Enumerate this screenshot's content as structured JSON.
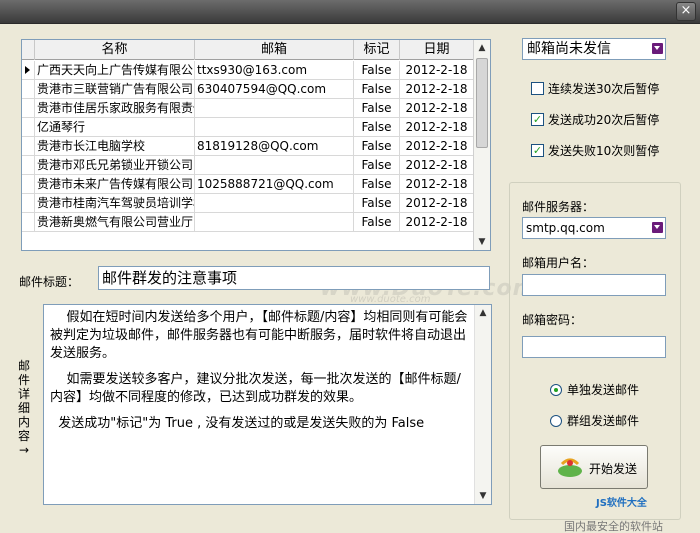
{
  "window": {
    "close_glyph": "×"
  },
  "grid": {
    "columns": [
      "名称",
      "邮箱",
      "标记",
      "日期"
    ],
    "rows": [
      {
        "name": "广西天天向上广告传媒有限公司",
        "email": "ttxs930@163.com",
        "flag": "False",
        "date": "2012-2-18",
        "current": true
      },
      {
        "name": "贵港市三联营销广告有限公司",
        "email": "630407594@QQ.com",
        "flag": "False",
        "date": "2012-2-18"
      },
      {
        "name": "贵港市佳居乐家政服务有限责任公司",
        "email": "",
        "flag": "False",
        "date": "2012-2-18"
      },
      {
        "name": "亿通琴行",
        "email": "",
        "flag": "False",
        "date": "2012-2-18"
      },
      {
        "name": "贵港市长江电脑学校",
        "email": "81819128@QQ.com",
        "flag": "False",
        "date": "2012-2-18"
      },
      {
        "name": "贵港市邓氏兄弟锁业开锁公司",
        "email": "",
        "flag": "False",
        "date": "2012-2-18"
      },
      {
        "name": "贵港市未来广告传媒有限公司",
        "email": "1025888721@QQ.com",
        "flag": "False",
        "date": "2012-2-18"
      },
      {
        "name": "贵港市桂南汽车驾驶员培训学校",
        "email": "",
        "flag": "False",
        "date": "2012-2-18"
      },
      {
        "name": "贵港新奥燃气有限公司营业厅",
        "email": "",
        "flag": "False",
        "date": "2012-2-18"
      }
    ]
  },
  "subject": {
    "label": "邮件标题：",
    "value": "邮件群发的注意事项"
  },
  "body": {
    "label_chars": [
      "邮",
      "件",
      "详",
      "细",
      "内",
      "容",
      "→"
    ],
    "paragraphs": [
      "    假如在短时间内发送给多个用户，【邮件标题/内容】均相同则有可能会被判定为垃圾邮件，邮件服务器也有可能中断服务，届时软件将自动退出发送服务。",
      "    如需要发送较多客户，建议分批次发送，每一批次发送的【邮件标题/内容】均做不同程度的修改，已达到成功群发的效果。",
      "  发送成功\"标记\"为 True , 没有发送过的或是发送失败的为 False"
    ]
  },
  "filter_select": {
    "value": "邮箱尚未发信"
  },
  "options": [
    {
      "label": "连续发送30次后暂停",
      "checked": false
    },
    {
      "label": "发送成功20次后暂停",
      "checked": true
    },
    {
      "label": "发送失败10次则暂停",
      "checked": true
    }
  ],
  "server": {
    "label": "邮件服务器：",
    "value": "smtp.qq.com"
  },
  "username": {
    "label": "邮箱用户名：",
    "value": ""
  },
  "password": {
    "label": "邮箱密码：",
    "value": ""
  },
  "send_mode": [
    {
      "label": "单独发送邮件",
      "selected": true
    },
    {
      "label": "群组发送邮件",
      "selected": false
    }
  ],
  "start_button": {
    "label": "开始发送"
  },
  "watermarks": {
    "main": "www.DuoTe.com",
    "sub": "www.duote.com",
    "brand": "JS软件大全",
    "slogan": "国内最安全的软件站"
  }
}
